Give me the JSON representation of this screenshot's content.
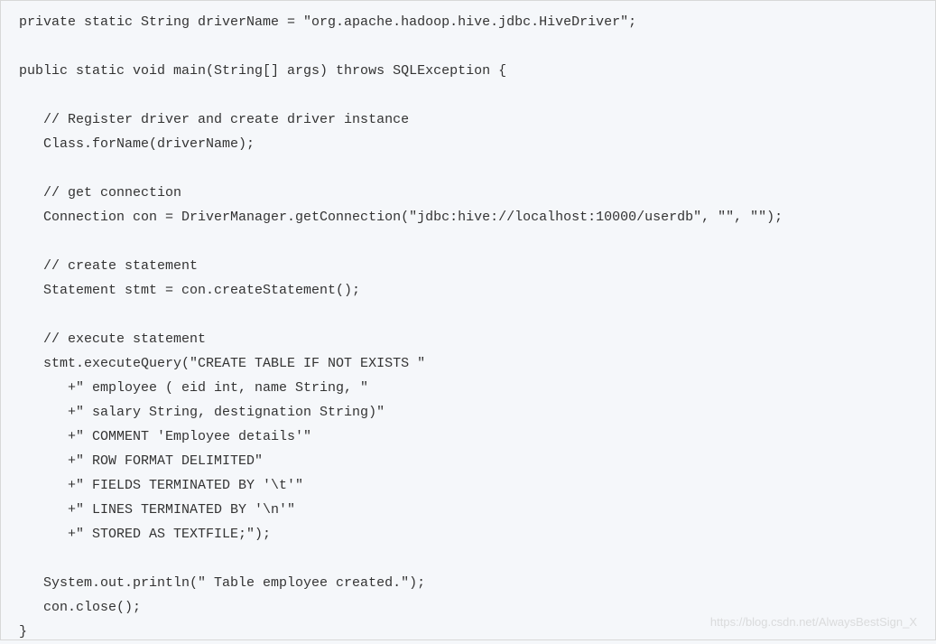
{
  "code": {
    "line01": "private static String driverName = \"org.apache.hadoop.hive.jdbc.HiveDriver\";",
    "line02": "",
    "line03": "public static void main(String[] args) throws SQLException {",
    "line04": "",
    "line05": "   // Register driver and create driver instance",
    "line06": "   Class.forName(driverName);",
    "line07": "",
    "line08": "   // get connection",
    "line09": "   Connection con = DriverManager.getConnection(\"jdbc:hive://localhost:10000/userdb\", \"\", \"\");",
    "line10": "",
    "line11": "   // create statement",
    "line12": "   Statement stmt = con.createStatement();",
    "line13": "",
    "line14": "   // execute statement",
    "line15": "   stmt.executeQuery(\"CREATE TABLE IF NOT EXISTS \"",
    "line16": "      +\" employee ( eid int, name String, \"",
    "line17": "      +\" salary String, destignation String)\"",
    "line18": "      +\" COMMENT 'Employee details'\"",
    "line19": "      +\" ROW FORMAT DELIMITED\"",
    "line20": "      +\" FIELDS TERMINATED BY '\\t'\"",
    "line21": "      +\" LINES TERMINATED BY '\\n'\"",
    "line22": "      +\" STORED AS TEXTFILE;\");",
    "line23": "",
    "line24": "   System.out.println(\" Table employee created.\");",
    "line25": "   con.close();",
    "line26": "}"
  },
  "watermark": "https://blog.csdn.net/AlwaysBestSign_X"
}
